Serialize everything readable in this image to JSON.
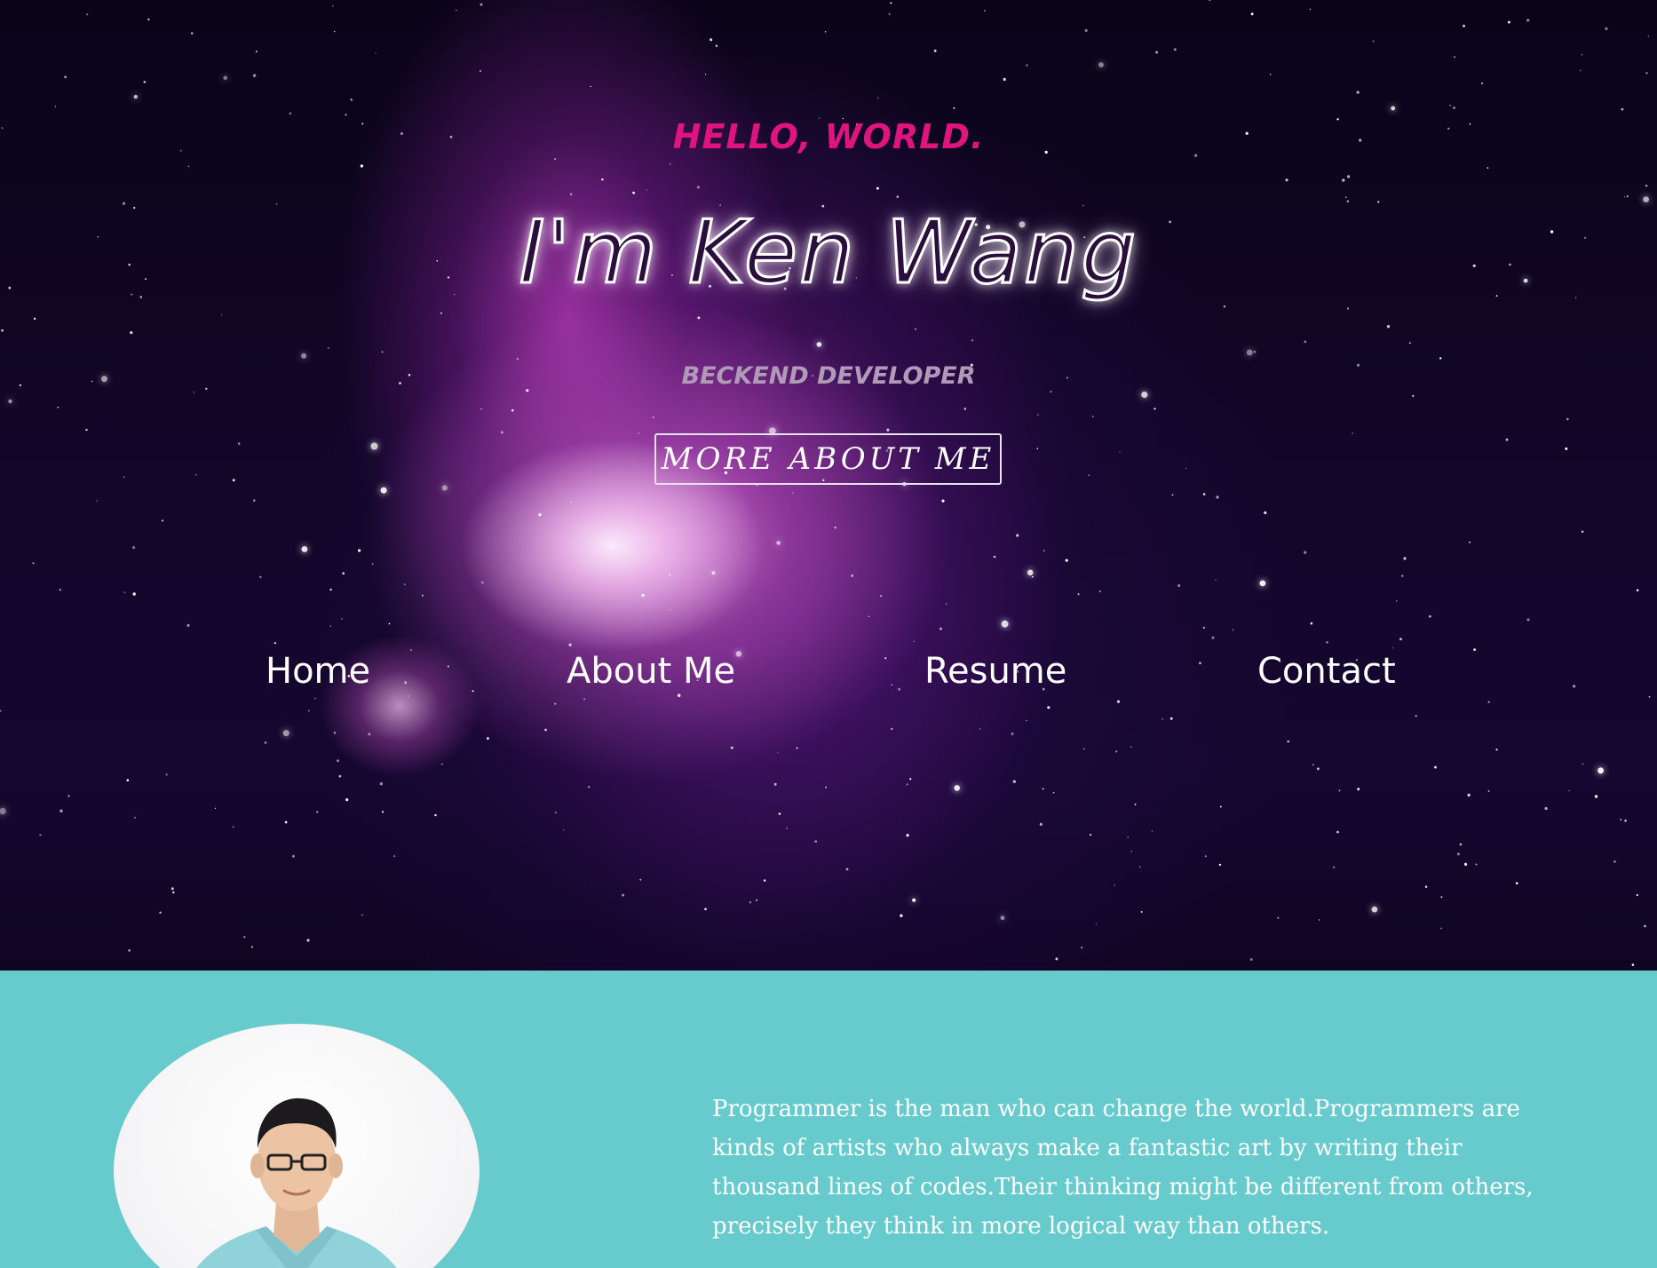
{
  "hero": {
    "greeting": "HELLO, WORLD.",
    "name": "I'm Ken Wang",
    "role": "BECKEND DEVELOPER",
    "cta_label": "MORE ABOUT ME"
  },
  "nav": {
    "items": [
      {
        "label": "Home"
      },
      {
        "label": "About Me"
      },
      {
        "label": "Resume"
      },
      {
        "label": "Contact"
      }
    ]
  },
  "about": {
    "avatar_alt": "portrait",
    "bio": "Programmer is the man who can change the world.Programmers are kinds of artists who always make a fantastic art by writing their thousand lines of codes.Their thinking might be different from others, precisely they think in more logical way than others."
  },
  "colors": {
    "greeting": "#e0147f",
    "about_bg": "#67cbcd",
    "role": "#b19ab8"
  }
}
